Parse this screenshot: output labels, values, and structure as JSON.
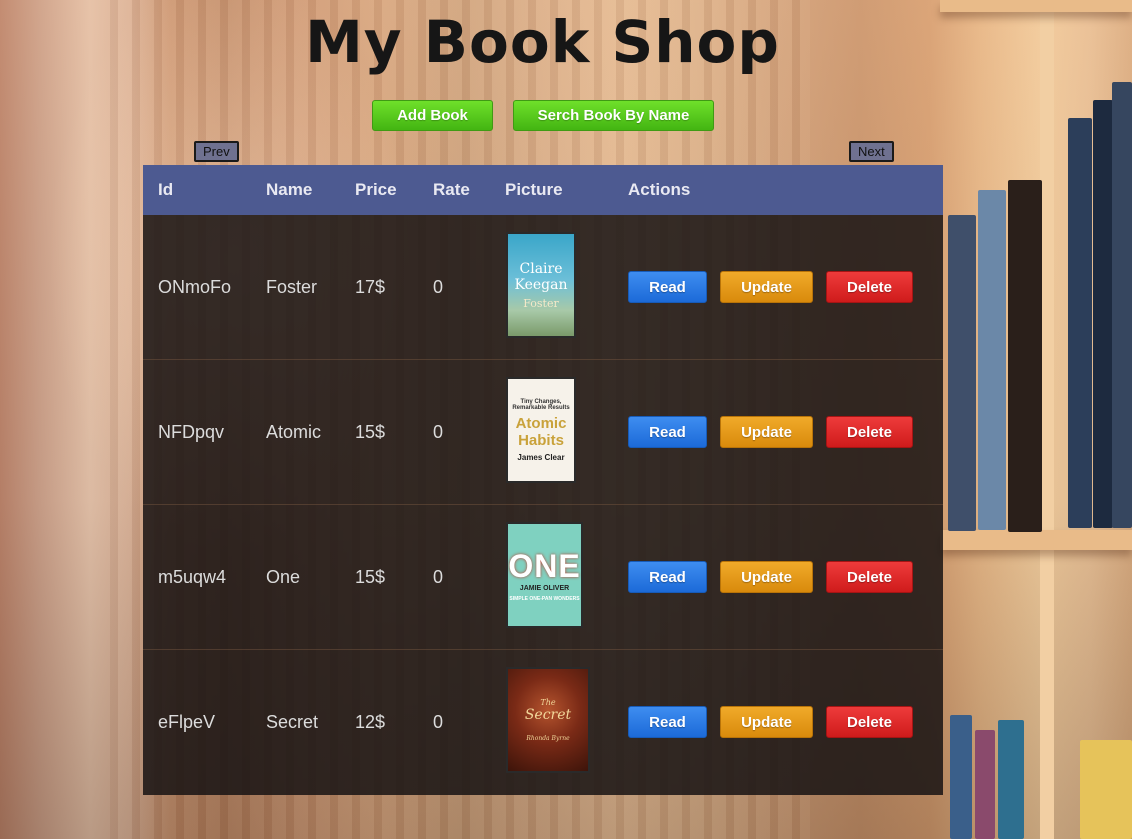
{
  "page": {
    "title": "My Book Shop"
  },
  "toolbar": {
    "add_label": "Add Book",
    "search_label": "Serch Book By Name"
  },
  "pagination": {
    "prev_label": "Prev",
    "next_label": "Next"
  },
  "table": {
    "headers": [
      "Id",
      "Name",
      "Price",
      "Rate",
      "Picture",
      "Actions"
    ],
    "rows": [
      {
        "id": "ONmoFo",
        "name": "Foster",
        "price": "17$",
        "rate": "0",
        "cover": {
          "line1": "Claire",
          "line2": "Keegan",
          "line3": "Foster"
        }
      },
      {
        "id": "NFDpqv",
        "name": "Atomic",
        "price": "15$",
        "rate": "0",
        "cover": {
          "line1": "Tiny Changes, Remarkable Results",
          "line2": "Atomic Habits",
          "line3": "James Clear"
        }
      },
      {
        "id": "m5uqw4",
        "name": "One",
        "price": "15$",
        "rate": "0",
        "cover": {
          "line1": "ONE",
          "line2": "JAMIE OLIVER",
          "line3": "SIMPLE ONE-PAN WONDERS"
        }
      },
      {
        "id": "eFlpeV",
        "name": "Secret",
        "price": "12$",
        "rate": "0",
        "cover": {
          "line1": "The",
          "line2": "Secret",
          "line3": "Rhonda Byrne"
        }
      }
    ],
    "actions": {
      "read": "Read",
      "update": "Update",
      "delete": "Delete"
    }
  },
  "colors": {
    "header": "#4d5a91",
    "add_button": "#43b512",
    "read_button": "#1c6ad8",
    "update_button": "#d98a0c",
    "delete_button": "#cf1b1b"
  }
}
